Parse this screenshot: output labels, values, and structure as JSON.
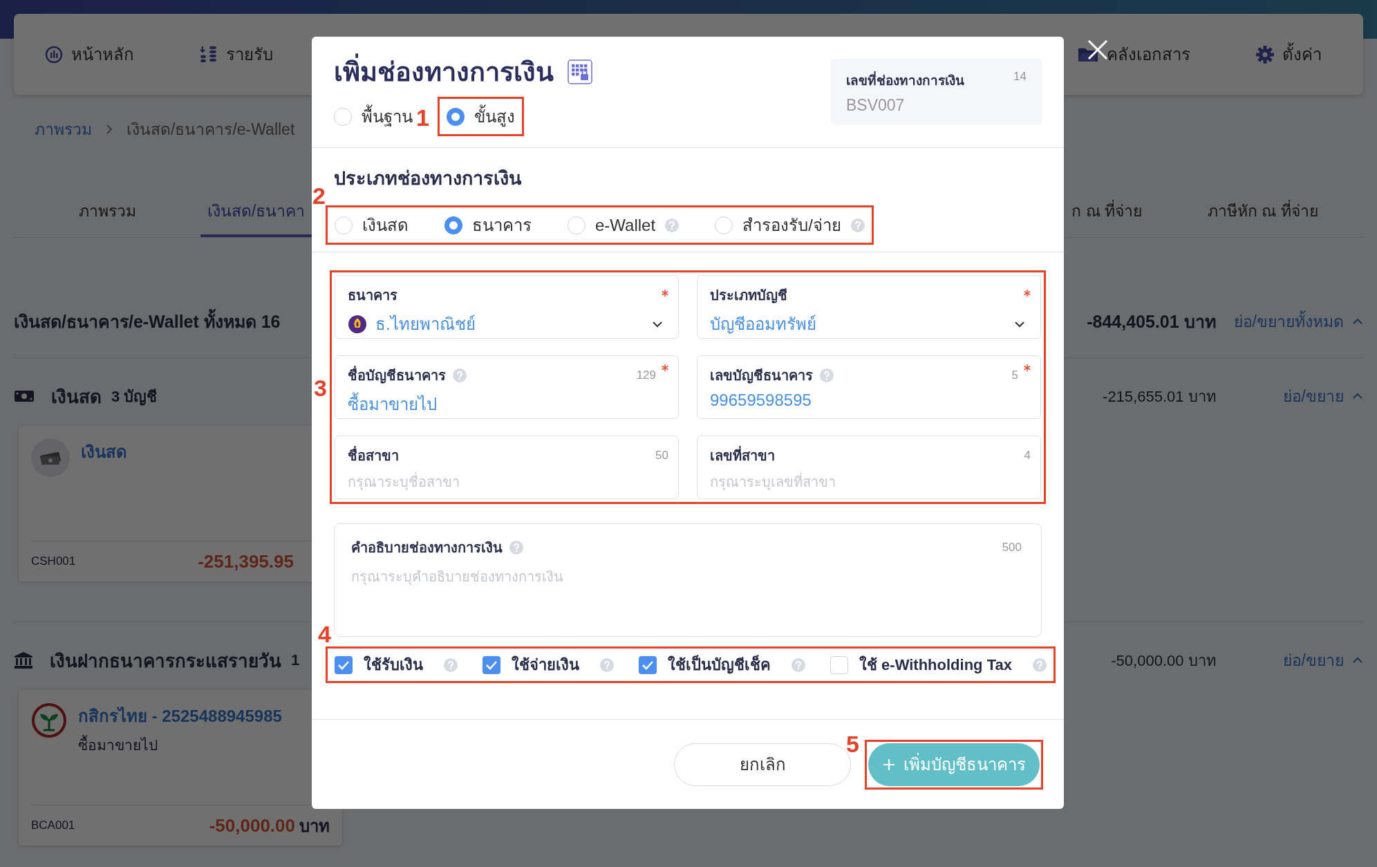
{
  "top_nav": {
    "left_items": [
      {
        "kind": "dashboard",
        "label": "หน้าหลัก"
      },
      {
        "kind": "income",
        "label": "รายรับ"
      }
    ],
    "right_items": [
      {
        "kind": "documents",
        "label": "คลังเอกสาร"
      },
      {
        "kind": "settings",
        "label": "ตั้งค่า"
      }
    ]
  },
  "breadcrumb": [
    {
      "label": "ภาพรวม",
      "link": true
    },
    {
      "label": "เงินสด/ธนาคาร/e-Wallet",
      "link": false
    }
  ],
  "tabs": [
    {
      "label": "ภาพรวม",
      "selected": false
    },
    {
      "label": "เงินสด/ธนาคา",
      "selected": true
    }
  ],
  "right_tabs": [
    {
      "label": "ก ณ ที่จ่าย",
      "selected": false
    },
    {
      "label": "ภาษีหัก ณ ที่จ่าย",
      "selected": false
    }
  ],
  "summary": {
    "title": "เงินสด/ธนาคาร/e-Wallet ทั้งหมด 16",
    "total": "-844,405.01 บาท",
    "toggle": "ย่อ/ขยายทั้งหมด"
  },
  "groups": [
    {
      "kind": "cash",
      "title": "เงินสด",
      "count": "3 บัญชี",
      "total": "-215,655.01 บาท",
      "toggle": "ย่อ/ขยาย",
      "card": {
        "kind": "cash",
        "name": "เงินสด",
        "code": "CSH001",
        "amount": "-251,395.95"
      }
    },
    {
      "kind": "bank",
      "title": "เงินฝากธนาคารกระแสรายวัน",
      "count": "1",
      "total": "-50,000.00 บาท",
      "toggle": "ย่อ/ขยาย",
      "card": {
        "kind": "bank",
        "name": "กสิกรไทย - 2525488945985",
        "subtitle": "ซื้อมาขายไป",
        "code": "BCA001",
        "amount": "-50,000.00",
        "unit": "บาท"
      }
    }
  ],
  "dialog": {
    "title": "เพิ่มช่องทางการเงิน",
    "mode_options": [
      {
        "label": "พื้นฐาน",
        "selected": false
      },
      {
        "label": "ขั้นสูง",
        "selected": true
      }
    ],
    "doc_number": {
      "label": "เลขที่ช่องทางการเงิน",
      "count": "14",
      "value": "BSV007"
    },
    "type_heading": "ประเภทช่องทางการเงิน",
    "type_options": [
      {
        "label": "เงินสด",
        "selected": false,
        "help": false
      },
      {
        "label": "ธนาคาร",
        "selected": true,
        "help": false
      },
      {
        "label": "e-Wallet",
        "selected": false,
        "help": true
      },
      {
        "label": "สำรองรับ/จ่าย",
        "selected": false,
        "help": true
      }
    ],
    "fields": [
      {
        "kind": "select",
        "label": "ธนาคาร",
        "required": true,
        "help": false,
        "value": "ธ.ไทยพาณิชย์",
        "logo": true
      },
      {
        "kind": "select",
        "label": "ประเภทบัญชี",
        "required": true,
        "help": false,
        "value": "บัญชีออมทรัพย์",
        "logo": false
      },
      {
        "kind": "text",
        "label": "ชื่อบัญชีธนาคาร",
        "required": true,
        "help": true,
        "count": "129",
        "value": "ซื้อมาขายไป"
      },
      {
        "kind": "text",
        "label": "เลขบัญชีธนาคาร",
        "required": true,
        "help": true,
        "count": "5",
        "value": "99659598595"
      },
      {
        "kind": "text",
        "label": "ชื่อสาขา",
        "required": false,
        "help": false,
        "count": "50",
        "placeholder": "กรุณาระบุชื่อสาขา"
      },
      {
        "kind": "text",
        "label": "เลขที่สาขา",
        "required": false,
        "help": false,
        "count": "4",
        "placeholder": "กรุณาระบุเลขที่สาขา"
      }
    ],
    "description": {
      "label": "คำอธิบายช่องทางการเงิน",
      "help": true,
      "count": "500",
      "placeholder": "กรุณาระบุคำอธิบายช่องทางการเงิน"
    },
    "options": [
      {
        "label": "ใช้รับเงิน",
        "checked": true
      },
      {
        "label": "ใช้จ่ายเงิน",
        "checked": true
      },
      {
        "label": "ใช้เป็นบัญชีเช็ค",
        "checked": true
      },
      {
        "label": "ใช้ e-Withholding Tax",
        "checked": false
      }
    ],
    "buttons": [
      {
        "kind": "secondary",
        "label": "ยกเลิก"
      },
      {
        "kind": "primary",
        "label": "เพิ่มบัญชีธนาคาร"
      }
    ]
  },
  "callouts": {
    "mode": "1",
    "type": "2",
    "fields": "3",
    "options": "4",
    "submit": "5"
  }
}
